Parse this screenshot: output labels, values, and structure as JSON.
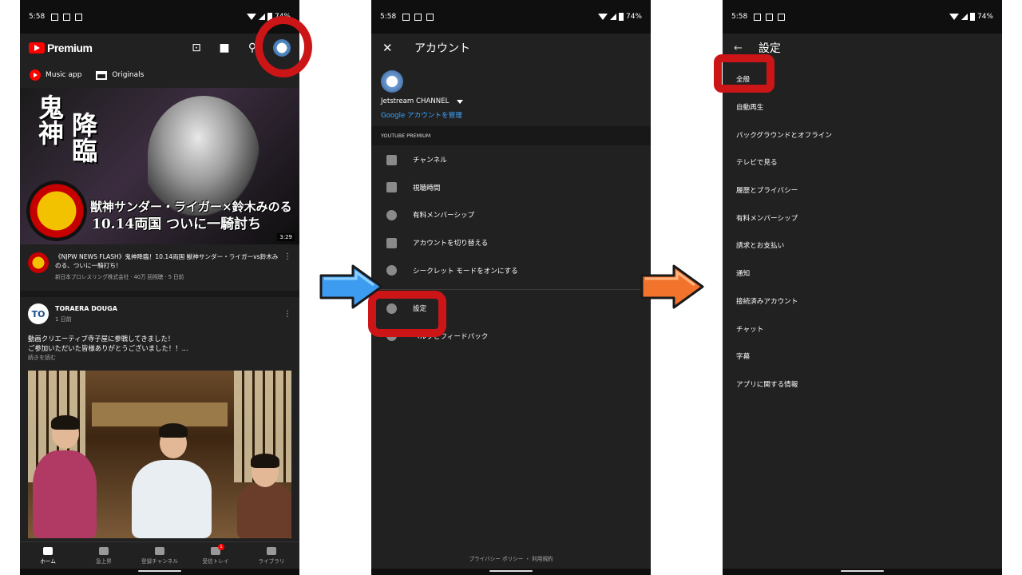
{
  "status": {
    "time": "5:58",
    "battery": "74%"
  },
  "home": {
    "brand": "Premium",
    "chips": [
      "Music app",
      "Originals"
    ],
    "thumb": {
      "kanji1": "鬼神",
      "kanji2": "降臨",
      "caption1": "獣神サンダー・ライガー×鈴木みのる",
      "caption2": "10.14両国 ついに一騎討ち",
      "duration": "3:29"
    },
    "video": {
      "title": "《NJPW NEWS FLASH》鬼神降臨！10.14両国 獣神サンダー・ライガーvs鈴木みのる、ついに一騎打ち！",
      "sub": "新日本プロレスリング株式会社 · 40万 回視聴 · 5 日前"
    },
    "post": {
      "author": "TORAERA DOUGA",
      "avatar_text": "TO",
      "time": "1 日前",
      "line1": "動画クリエーティブ寺子屋に参戦してきました！",
      "line2": "ご参加いただいた皆様ありがとうございました！！...",
      "more": "続きを読む"
    },
    "nav": [
      {
        "label": "ホーム"
      },
      {
        "label": "急上昇"
      },
      {
        "label": "登録チャンネル"
      },
      {
        "label": "受信トレイ",
        "badge": "1"
      },
      {
        "label": "ライブラリ"
      }
    ]
  },
  "account": {
    "title": "アカウント",
    "user": "Jetstream CHANNEL",
    "manage": "Google アカウントを管理",
    "section": "YOUTUBE PREMIUM",
    "menu": [
      "チャンネル",
      "視聴時間",
      "有料メンバーシップ",
      "アカウントを切り替える",
      "シークレット モードをオンにする",
      "設定",
      "ヘルプとフィードバック"
    ],
    "legal": "プライバシー ポリシー ・ 利用規約"
  },
  "settings": {
    "title": "設定",
    "items": [
      "全般",
      "自動再生",
      "バックグラウンドとオフライン",
      "テレビで見る",
      "履歴とプライバシー",
      "有料メンバーシップ",
      "請求とお支払い",
      "通知",
      "接続済みアカウント",
      "チャット",
      "字幕",
      "アプリに関する情報"
    ]
  },
  "colors": {
    "highlight": "#cc1517",
    "arrow_blue": "#3d9cf0",
    "arrow_orange": "#f2732c",
    "background": "#212121",
    "link": "#3ea6ff"
  }
}
